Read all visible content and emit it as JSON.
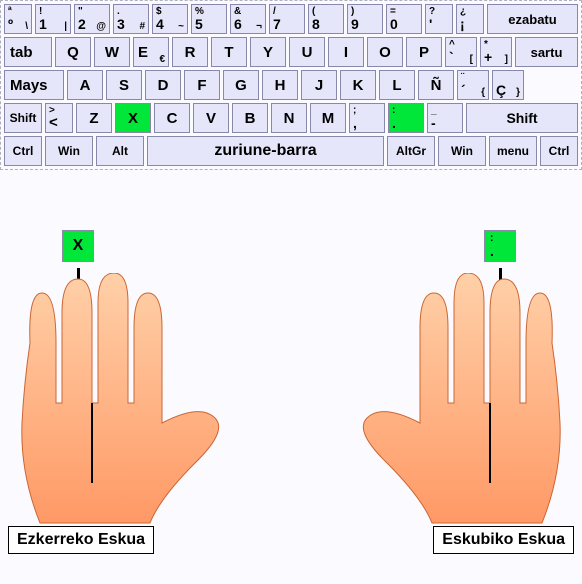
{
  "keyboard": {
    "row0": {
      "k0": {
        "tl": "ª",
        "bl": "º",
        "br": "\\"
      },
      "k1": {
        "tl": "!",
        "bl": "1",
        "br": "|"
      },
      "k2": {
        "tl": "\"",
        "bl": "2",
        "br": "@"
      },
      "k3": {
        "tl": ".",
        "bl": "3",
        "br": "#"
      },
      "k4": {
        "tl": "$",
        "bl": "4",
        "br": "~"
      },
      "k5": {
        "tl": "%",
        "bl": "5"
      },
      "k6": {
        "tl": "&",
        "bl": "6",
        "br": "¬"
      },
      "k7": {
        "tl": "/",
        "bl": "7"
      },
      "k8": {
        "tl": "(",
        "bl": "8"
      },
      "k9": {
        "tl": ")",
        "bl": "9"
      },
      "k10": {
        "tl": "=",
        "bl": "0"
      },
      "k11": {
        "tl": "?",
        "bl": "'"
      },
      "k12": {
        "tl": "¿",
        "bl": "¡"
      },
      "backspace": "ezabatu"
    },
    "row1": {
      "tab": "tab",
      "letters": [
        "Q",
        "W",
        "E",
        "R",
        "T",
        "Y",
        "U",
        "I",
        "O",
        "P"
      ],
      "euro": "€",
      "k11": {
        "tl": "^",
        "bl": "`",
        "br": "["
      },
      "k12": {
        "tl": "*",
        "bl": "+",
        "br": "]"
      },
      "enter": "sartu"
    },
    "row2": {
      "caps": "Mays",
      "letters": [
        "A",
        "S",
        "D",
        "F",
        "G",
        "H",
        "J",
        "K",
        "L",
        "Ñ"
      ],
      "k11": {
        "tl": "¨",
        "bl": "´",
        "br": "{"
      },
      "k12": {
        "bl": "Ç",
        "br": "}"
      }
    },
    "row3": {
      "lshift": "Shift",
      "k1": {
        "tl": ">",
        "bl": "<"
      },
      "letters": [
        "Z",
        "X",
        "C",
        "V",
        "B",
        "N",
        "M"
      ],
      "k9": {
        "tl": ";",
        "bl": ","
      },
      "k10": {
        "tl": ":",
        "bl": "."
      },
      "k11": {
        "tl": "_",
        "bl": "-"
      },
      "rshift": "Shift"
    },
    "row4": {
      "lctrl": "Ctrl",
      "lwin": "Win",
      "lalt": "Alt",
      "space": "zuriune-barra",
      "altgr": "AltGr",
      "rwin": "Win",
      "menu": "menu",
      "rctrl": "Ctrl"
    }
  },
  "cues": {
    "left": {
      "letter": "X"
    },
    "right": {
      "letter": "."
    }
  },
  "labels": {
    "left": "Ezkerreko Eskua",
    "right": "Eskubiko Eskua"
  }
}
